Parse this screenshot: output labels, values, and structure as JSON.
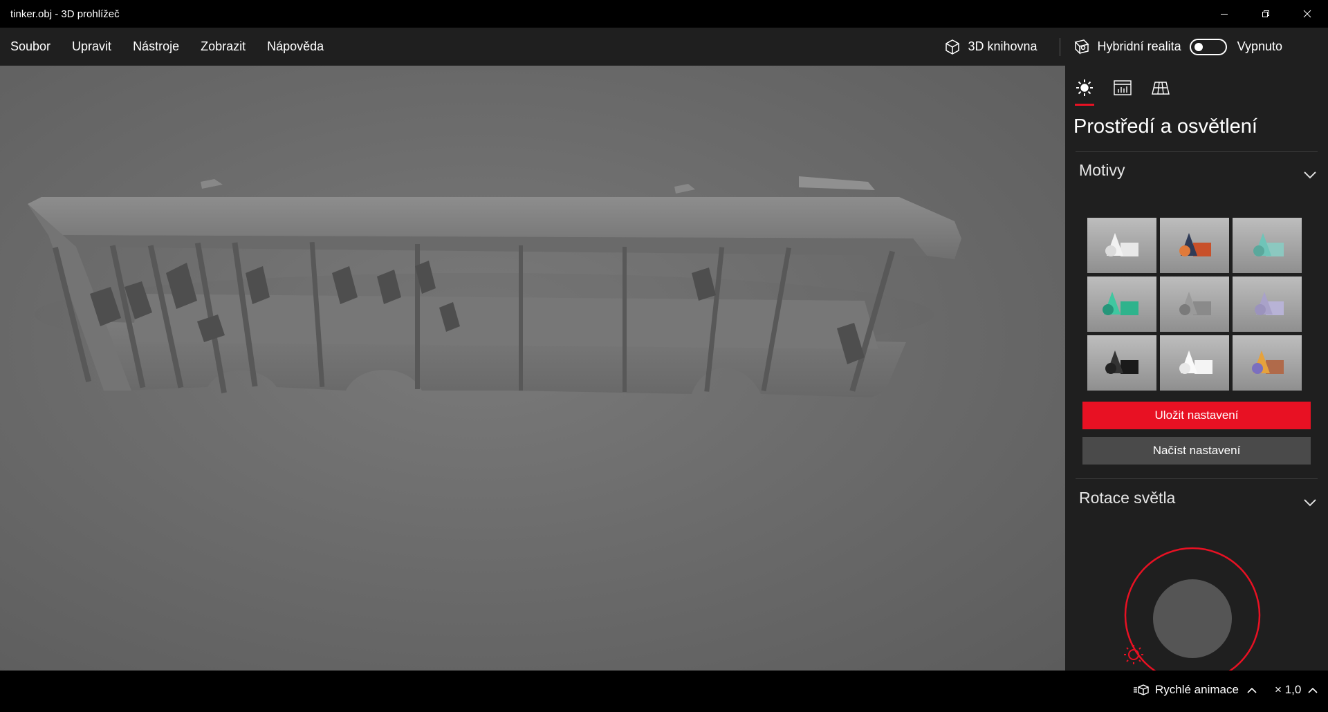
{
  "window": {
    "title": "tinker.obj - 3D prohlížeč"
  },
  "menu": {
    "items": [
      "Soubor",
      "Upravit",
      "Nástroje",
      "Zobrazit",
      "Nápověda"
    ],
    "library_label": "3D knihovna",
    "mixed_reality_label": "Hybridní realita",
    "mixed_reality_state": "Vypnuto",
    "mixed_reality_on": false
  },
  "panel": {
    "title": "Prostředí a osvětlení",
    "sections": {
      "themes": "Motivy",
      "light_rotation": "Rotace světla"
    },
    "save_button": "Uložit nastavení",
    "load_button": "Načíst nastavení",
    "theme_thumbnails": [
      {
        "icon": "theme-white-thumbnail",
        "color": "#e6e6e6"
      },
      {
        "icon": "theme-orange-navy-thumbnail",
        "color": "#c8502a"
      },
      {
        "icon": "theme-teal-thumbnail",
        "color": "#6fc4b8"
      },
      {
        "icon": "theme-green-thumbnail",
        "color": "#2fb38c"
      },
      {
        "icon": "theme-gray-thumbnail",
        "color": "#8a8a8a"
      },
      {
        "icon": "theme-lavender-thumbnail",
        "color": "#a9a2c9"
      },
      {
        "icon": "theme-black-thumbnail",
        "color": "#222222"
      },
      {
        "icon": "theme-white-bright-thumbnail",
        "color": "#f2f2f2"
      },
      {
        "icon": "theme-purple-orange-thumbnail",
        "color": "#7b6fbf"
      }
    ],
    "accent_color": "#e81123"
  },
  "status": {
    "animation_label": "Rychlé animace",
    "speed_label": "× 1,0"
  }
}
